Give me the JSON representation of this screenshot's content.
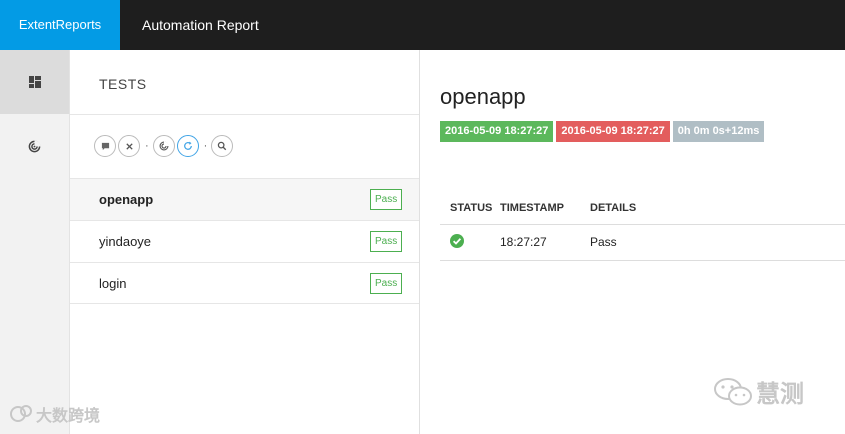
{
  "header": {
    "brand": "ExtentReports",
    "report_name": "Automation Report"
  },
  "sidenav": {
    "items": [
      {
        "icon": "dashboard-icon",
        "active": true
      },
      {
        "icon": "analysis-icon",
        "active": false
      }
    ]
  },
  "test_list": {
    "title": "TESTS",
    "filters": [
      "comment-icon",
      "x-icon",
      "dot",
      "chart-icon",
      "refresh-icon",
      "dot",
      "search-icon"
    ],
    "items": [
      {
        "name": "openapp",
        "status": "Pass",
        "active": true
      },
      {
        "name": "yindaoye",
        "status": "Pass",
        "active": false
      },
      {
        "name": "login",
        "status": "Pass",
        "active": false
      }
    ]
  },
  "detail": {
    "title": "openapp",
    "start_time": "2016-05-09 18:27:27",
    "end_time": "2016-05-09 18:27:27",
    "duration": "0h 0m 0s+12ms",
    "log_columns": [
      "STATUS",
      "TIMESTAMP",
      "DETAILS"
    ],
    "logs": [
      {
        "status_icon": "pass-check-icon",
        "timestamp": "18:27:27",
        "details": "Pass"
      }
    ]
  },
  "colors": {
    "brand": "#039be5",
    "topbar": "#1e1e1e",
    "pass": "#4caf50",
    "fail": "#e35d5d",
    "neutral": "#b0bec5"
  },
  "watermarks": {
    "right": "慧测",
    "left": "大数跨境"
  }
}
